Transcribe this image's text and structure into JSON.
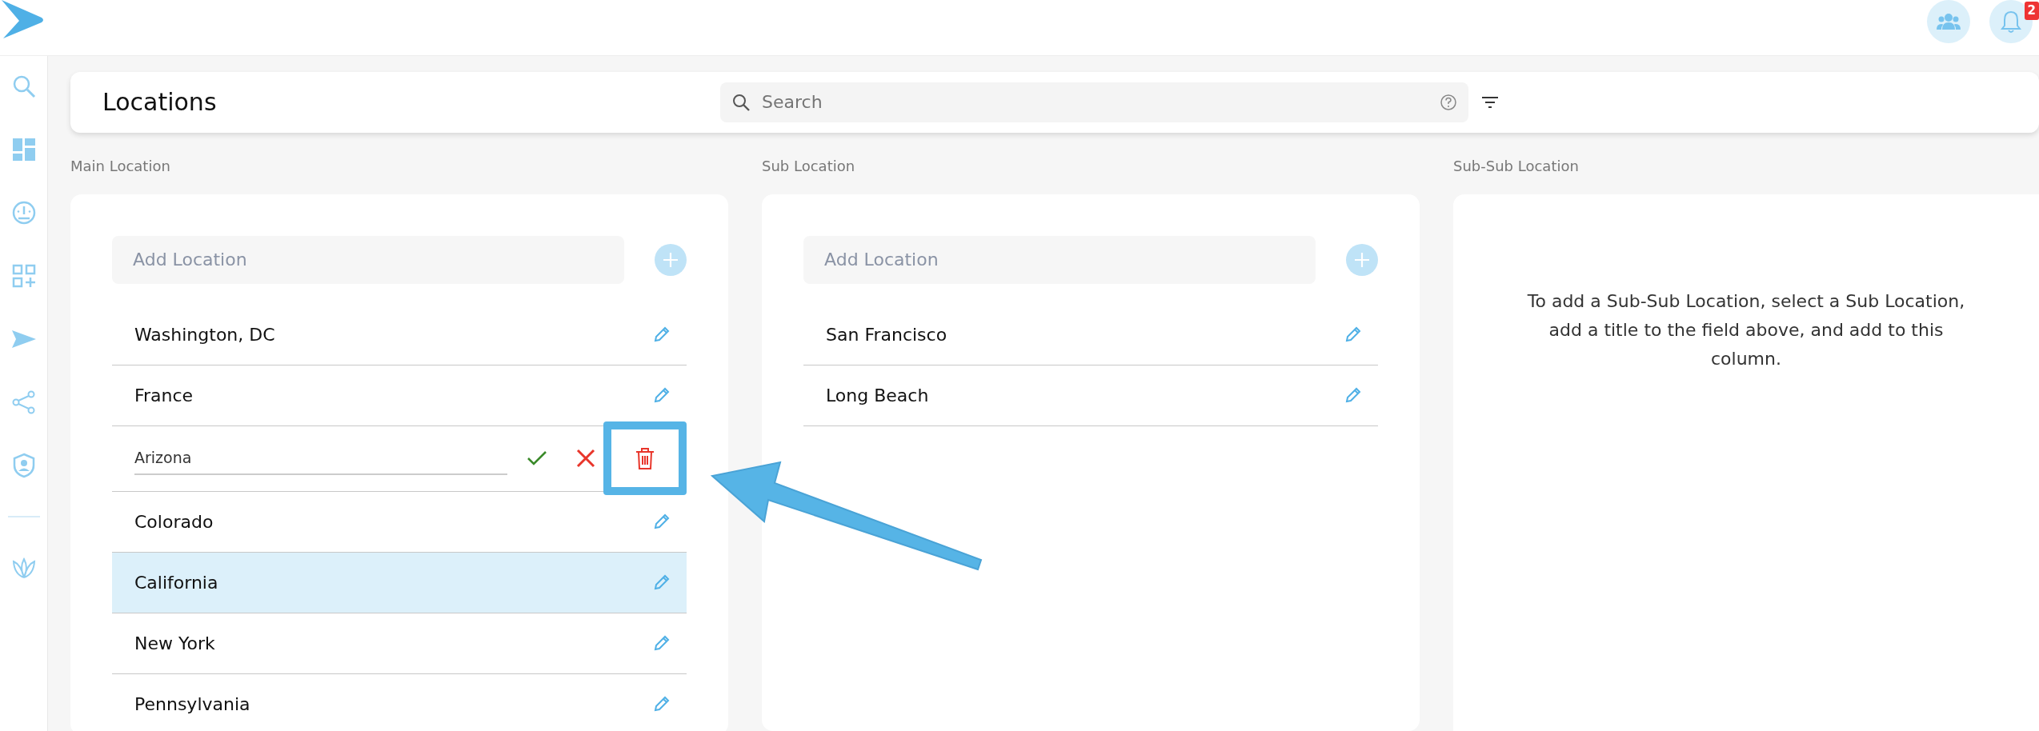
{
  "header": {
    "notifications_badge": "2"
  },
  "toolbar": {
    "title": "Locations",
    "search": {
      "placeholder": "Search"
    }
  },
  "columns": [
    {
      "label": "Main Location",
      "add_placeholder": "Add Location",
      "rows": [
        {
          "kind": "item",
          "text": "Washington, DC",
          "selected": false
        },
        {
          "kind": "item",
          "text": "France",
          "selected": false
        },
        {
          "kind": "editing",
          "value": "Arizona",
          "delete_highlighted": true
        },
        {
          "kind": "item",
          "text": "Colorado",
          "selected": false
        },
        {
          "kind": "item",
          "text": "California",
          "selected": true
        },
        {
          "kind": "item",
          "text": "New York",
          "selected": false
        },
        {
          "kind": "item",
          "text": "Pennsylvania",
          "selected": false
        }
      ]
    },
    {
      "label": "Sub Location",
      "add_placeholder": "Add Location",
      "rows": [
        {
          "kind": "item",
          "text": "San Francisco",
          "selected": false
        },
        {
          "kind": "item",
          "text": "Long Beach",
          "selected": false
        }
      ]
    },
    {
      "label": "Sub-Sub Location",
      "empty_message": "To add a Sub-Sub Location, select a Sub Location, add a title to the field above, and add to this column."
    }
  ]
}
